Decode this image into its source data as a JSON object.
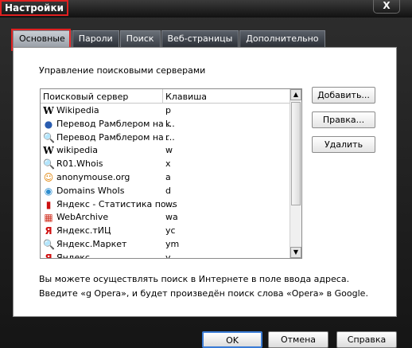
{
  "window": {
    "title": "Настройки",
    "close_label": "X"
  },
  "tabs": [
    {
      "label": "Основные"
    },
    {
      "label": "Пароли"
    },
    {
      "label": "Поиск"
    },
    {
      "label": "Веб-страницы"
    },
    {
      "label": "Дополнительно"
    }
  ],
  "panel": {
    "section_title": "Управление поисковыми серверами",
    "columns": {
      "server": "Поисковый сервер",
      "key": "Клавиша"
    },
    "servers": [
      {
        "name": "Wikipedia",
        "key": "p",
        "icon": "wikipedia-icon"
      },
      {
        "name": "Перевод Рамблером на ...",
        "key": "k",
        "icon": "rambler-icon"
      },
      {
        "name": "Перевод Рамблером на ...",
        "key": "r",
        "icon": "magnifier-icon"
      },
      {
        "name": "wikipedia",
        "key": "w",
        "icon": "wikipedia-icon"
      },
      {
        "name": "R01.Whois",
        "key": "x",
        "icon": "magnifier-icon"
      },
      {
        "name": "anonymouse.org",
        "key": "a",
        "icon": "anonymouse-icon"
      },
      {
        "name": "Domains WhoIs",
        "key": "d",
        "icon": "globe-icon"
      },
      {
        "name": "Яндекс - Статистика по...",
        "key": "ws",
        "icon": "bar-chart-icon"
      },
      {
        "name": "WebArchive",
        "key": "wa",
        "icon": "webarchive-icon"
      },
      {
        "name": "Яндекс.тИЦ",
        "key": "yc",
        "icon": "yandex-icon"
      },
      {
        "name": "Яндекс.Маркет",
        "key": "ym",
        "icon": "magnifier-icon"
      },
      {
        "name": "Яндекс",
        "key": "y",
        "icon": "yandex-icon"
      }
    ],
    "buttons": {
      "add": "Добавить...",
      "edit": "Правка...",
      "delete": "Удалить"
    },
    "hints": [
      "Вы можете осуществлять поиск в Интернете в поле ввода адреса.",
      "Введите «g Opera», и будет произведён поиск слова «Opera» в Google."
    ]
  },
  "footer": {
    "ok": "OK",
    "cancel": "Отмена",
    "help": "Справка"
  }
}
